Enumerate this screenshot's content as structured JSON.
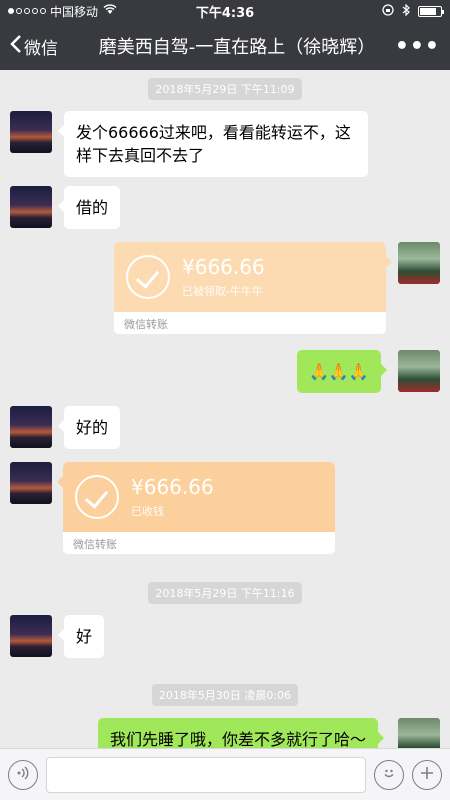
{
  "status_bar": {
    "carrier": "中国移动",
    "time": "下午4:36"
  },
  "nav": {
    "back_label": "微信",
    "title": "磨美西自驾-一直在路上（徐晓辉）",
    "more": "•••"
  },
  "messages": [
    {
      "type": "timestamp",
      "text": "2018年5月29日 下午11:09"
    },
    {
      "type": "text",
      "side": "left",
      "text": "发个66666过来吧，看看能转运不，这样下去真回不去了"
    },
    {
      "type": "text",
      "side": "left",
      "text": "借的"
    },
    {
      "type": "transfer",
      "side": "right",
      "amount": "¥666.66",
      "status": "已被领取-牛牛牛",
      "footer": "微信转账"
    },
    {
      "type": "text",
      "side": "right",
      "text": "🙏🙏🙏"
    },
    {
      "type": "text",
      "side": "left",
      "text": "好的"
    },
    {
      "type": "transfer",
      "side": "left",
      "amount": "¥666.66",
      "status": "已收钱",
      "footer": "微信转账"
    },
    {
      "type": "timestamp",
      "text": "2018年5月29日 下午11:16"
    },
    {
      "type": "text",
      "side": "left",
      "text": "好"
    },
    {
      "type": "timestamp",
      "text": "2018年5月30日 凌晨0:06"
    },
    {
      "type": "text",
      "side": "right",
      "text": "我们先睡了哦，你差不多就行了哈～"
    }
  ],
  "icons": {
    "back": "chevron-left-icon",
    "voice": "voice-icon",
    "emoji": "emoji-icon",
    "plus": "plus-icon"
  },
  "colors": {
    "nav_bg": "#393a3f",
    "chat_bg": "#ebebeb",
    "sent_bubble": "#a0e75a",
    "transfer": "#fcd09d"
  }
}
